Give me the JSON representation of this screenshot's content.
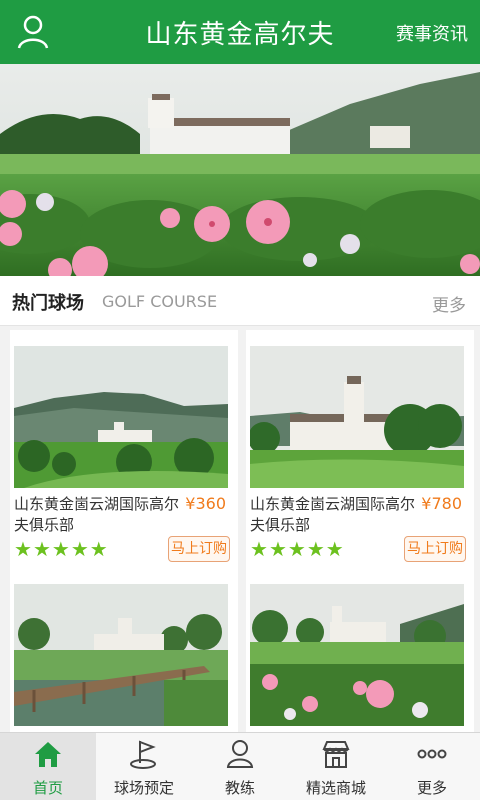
{
  "appbar": {
    "title": "山东黄金高尔夫",
    "right_link": "赛事资讯",
    "user_icon": "user-icon"
  },
  "banner": {
    "slide_count": 5,
    "active_index": 0
  },
  "section": {
    "title": "热门球场",
    "subtitle": "GOLF COURSE",
    "more": "更多"
  },
  "courses": [
    {
      "name": "山东黄金崮云湖国际高尔夫俱乐部",
      "price": "¥360",
      "rating": 5,
      "book_label": "马上订购"
    },
    {
      "name": "山东黄金崮云湖国际高尔夫俱乐部",
      "price": "¥780",
      "rating": 5,
      "book_label": "马上订购"
    },
    {
      "name": "",
      "price": "",
      "rating": 0,
      "book_label": ""
    },
    {
      "name": "",
      "price": "",
      "rating": 0,
      "book_label": ""
    }
  ],
  "tabbar": {
    "items": [
      {
        "label": "首页",
        "icon": "home-icon",
        "active": true
      },
      {
        "label": "球场预定",
        "icon": "golf-flag-icon",
        "active": false
      },
      {
        "label": "教练",
        "icon": "person-icon",
        "active": false
      },
      {
        "label": "精选商城",
        "icon": "shop-icon",
        "active": false
      },
      {
        "label": "更多",
        "icon": "more-icon",
        "active": false
      }
    ]
  },
  "colors": {
    "brand_green": "#1f9c43",
    "price_orange": "#f07b1c",
    "star_green": "#6cc11f"
  }
}
